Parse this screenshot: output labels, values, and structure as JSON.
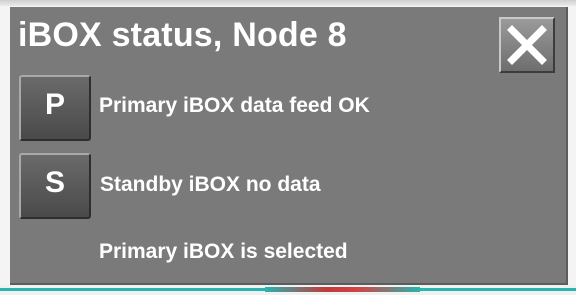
{
  "window": {
    "title": "iBOX status, Node 8"
  },
  "buttons": {
    "primary_label": "P",
    "standby_label": "S",
    "close_icon": "close-x-icon"
  },
  "status": {
    "primary_text": "Primary iBOX data feed OK",
    "standby_text": "Standby iBOX no data",
    "selected_text": "Primary iBOX is selected"
  },
  "colors": {
    "panel_bg": "#7a7a7a",
    "text": "#ffffff",
    "button_bg": "#5a5a5a",
    "accent_teal": "#2bb3b0",
    "accent_red": "#c23a3a"
  }
}
